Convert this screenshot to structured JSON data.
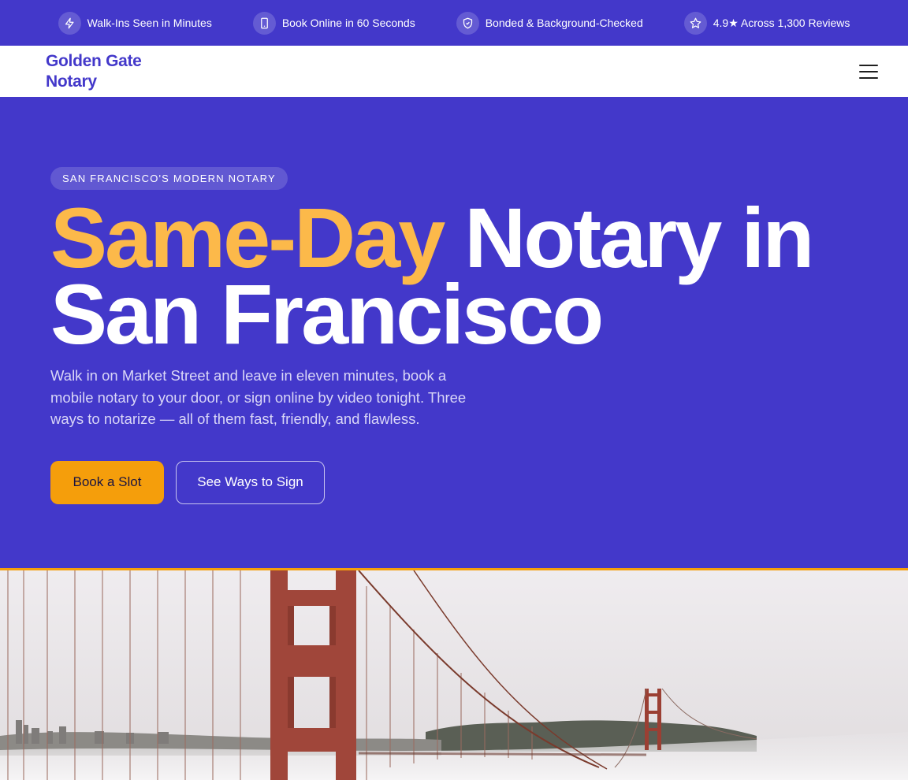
{
  "topbar": {
    "items": [
      {
        "icon": "lightning-icon",
        "label": "Walk-Ins Seen in Minutes"
      },
      {
        "icon": "phone-icon",
        "label": "Book Online in 60 Seconds"
      },
      {
        "icon": "shield-check-icon",
        "label": "Bonded & Background-Checked"
      },
      {
        "icon": "star-icon",
        "label": "4.9★ Across 1,300 Reviews"
      }
    ]
  },
  "navbar": {
    "logo_line1": "Golden Gate",
    "logo_line2": "Notary",
    "menu_icon": "hamburger-menu-icon"
  },
  "hero": {
    "badge": "SAN FRANCISCO'S MODERN NOTARY",
    "headline_accent": "Same-Day",
    "headline_rest": " Notary in San Francisco",
    "subcopy": "Walk in on Market Street and leave in eleven minutes, book a mobile notary to your door, or sign online by video tonight. Three ways to notarize — all of them fast, friendly, and flawless.",
    "primary_button": "Book a Slot",
    "secondary_button": "See Ways to Sign"
  },
  "colors": {
    "brand": "#4338CA",
    "accent": "#FCB94A",
    "button": "#F59E0B"
  }
}
